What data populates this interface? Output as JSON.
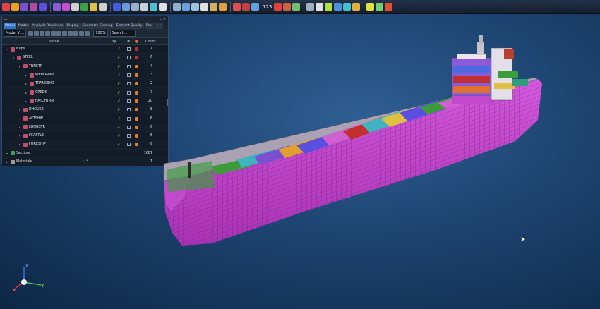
{
  "toolbar": {
    "zoom_text": "123",
    "colors": [
      "#e04444",
      "#f0a020",
      "#7a4fd0",
      "#b04aa0",
      "#5a4fe0",
      "#8a5ad8",
      "#c050d0",
      "#d0d0d0",
      "#3fa040",
      "#e0c040",
      "#d0d0d0",
      "#4060e0",
      "#6a9ad8",
      "#9ab0c8",
      "#c8d0d8",
      "#4cc0d0",
      "#e0e0e0",
      "#90b0d0",
      "#6aa0e0",
      "#a0c0e0",
      "#e0e0e0",
      "#d0b060",
      "#e0a040",
      "#e05050",
      "#c04040",
      "#60a0e0",
      "#e04040",
      "#d06040",
      "#70c070",
      "#a0b0c0",
      "#e0e0e0",
      "#b0e040",
      "#5090e0",
      "#40c0d0",
      "#e0b040",
      "#e0e040",
      "#70d070",
      "#e05030"
    ]
  },
  "panel": {
    "title": "☰",
    "controls": "– ×",
    "tabs": [
      {
        "label": "Model",
        "active": true
      },
      {
        "label": "Modes",
        "active": false
      },
      {
        "label": "Analysis Readiness",
        "active": false
      },
      {
        "label": "Display",
        "active": false
      },
      {
        "label": "Geometry Cleanup",
        "active": false
      },
      {
        "label": "Element Quality",
        "active": false
      },
      {
        "label": "Pool",
        "active": false
      },
      {
        "label": "+ •",
        "active": false
      }
    ],
    "view_select": "Model Vi…",
    "zoom": "100%",
    "search_placeholder": "Search...",
    "columns": {
      "name": "Name",
      "count": "Count"
    },
    "rows": [
      {
        "level": 0,
        "name": "Nups",
        "icon": "#c0506a",
        "count": "1",
        "color": "#c03030"
      },
      {
        "level": 1,
        "name": "STEEL",
        "icon": "#c0506a",
        "count": "6",
        "color": "#c03030"
      },
      {
        "level": 2,
        "name": "TRNSTR",
        "icon": "#c0506a",
        "count": "4",
        "color": "#e08020"
      },
      {
        "level": 3,
        "name": "WEBFRAME",
        "icon": "#c0506a",
        "count": "3",
        "color": "#e08020"
      },
      {
        "level": 3,
        "name": "TRANSBHD",
        "icon": "#c0506a",
        "count": "2",
        "color": "#e08020"
      },
      {
        "level": 3,
        "name": "CRSDK",
        "icon": "#c0506a",
        "count": "7",
        "color": "#e08020"
      },
      {
        "level": 3,
        "name": "HATCHTRN",
        "icon": "#c0506a",
        "count": "20",
        "color": "#e08020"
      },
      {
        "level": 2,
        "name": "DHOUSE",
        "icon": "#c0506a",
        "count": "8",
        "color": "#e08020"
      },
      {
        "level": 2,
        "name": "AFTSHIP",
        "icon": "#c0506a",
        "count": "6",
        "color": "#e08020"
      },
      {
        "level": 2,
        "name": "LONGSTR",
        "icon": "#c0506a",
        "count": "6",
        "color": "#e08020"
      },
      {
        "level": 2,
        "name": "FCASTLE",
        "icon": "#c0506a",
        "count": "6",
        "color": "#e08020"
      },
      {
        "level": 2,
        "name": "FORESHIP",
        "icon": "#c0506a",
        "count": "6",
        "color": "#e08020"
      },
      {
        "level": 0,
        "name": "Sections",
        "icon": "#40a060",
        "count": "1687",
        "color": ""
      },
      {
        "level": 0,
        "name": "Materials",
        "icon": "#a0a0a0",
        "count": "1",
        "color": ""
      }
    ]
  },
  "axis": {
    "x": "X",
    "y": "Y",
    "z": "Z"
  },
  "colors": {
    "hull": "#c84bd2",
    "deck": "#b2a8b8",
    "accent": "#2f72c8"
  }
}
